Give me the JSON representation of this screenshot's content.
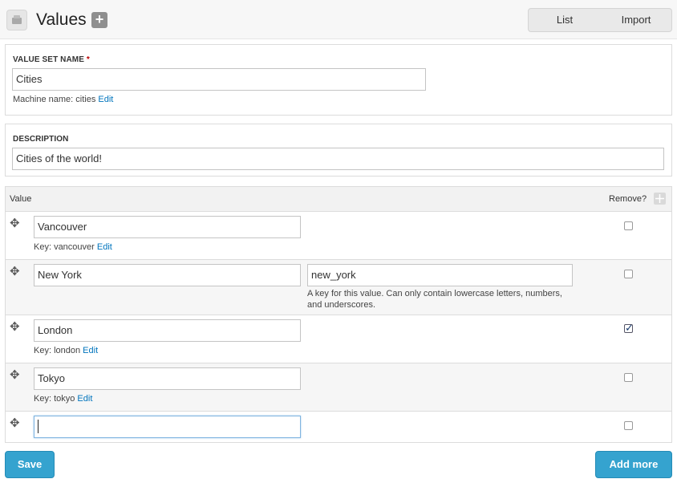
{
  "header": {
    "title": "Values",
    "add_symbol": "+",
    "tabs": [
      {
        "label": "List"
      },
      {
        "label": "Import"
      }
    ]
  },
  "value_set_name": {
    "label": "VALUE SET NAME",
    "required_marker": "*",
    "value": "Cities",
    "machine_name_prefix": "Machine name: cities",
    "edit_label": "Edit"
  },
  "description": {
    "label": "DESCRIPTION",
    "value": "Cities of the world!"
  },
  "table": {
    "col_value": "Value",
    "col_remove": "Remove?",
    "rows": [
      {
        "value": "Vancouver",
        "key_prefix": "Key: vancouver",
        "edit_label": "Edit",
        "remove_checked": false
      },
      {
        "value": "New York",
        "key_value": "new_york",
        "key_help": "A key for this value. Can only contain lowercase letters, numbers, and underscores.",
        "remove_checked": false
      },
      {
        "value": "London",
        "key_prefix": "Key: london",
        "edit_label": "Edit",
        "remove_checked": true
      },
      {
        "value": "Tokyo",
        "key_prefix": "Key: tokyo",
        "edit_label": "Edit",
        "remove_checked": false
      },
      {
        "value": "",
        "remove_checked": false
      }
    ]
  },
  "actions": {
    "save_label": "Save",
    "add_more_label": "Add more"
  }
}
